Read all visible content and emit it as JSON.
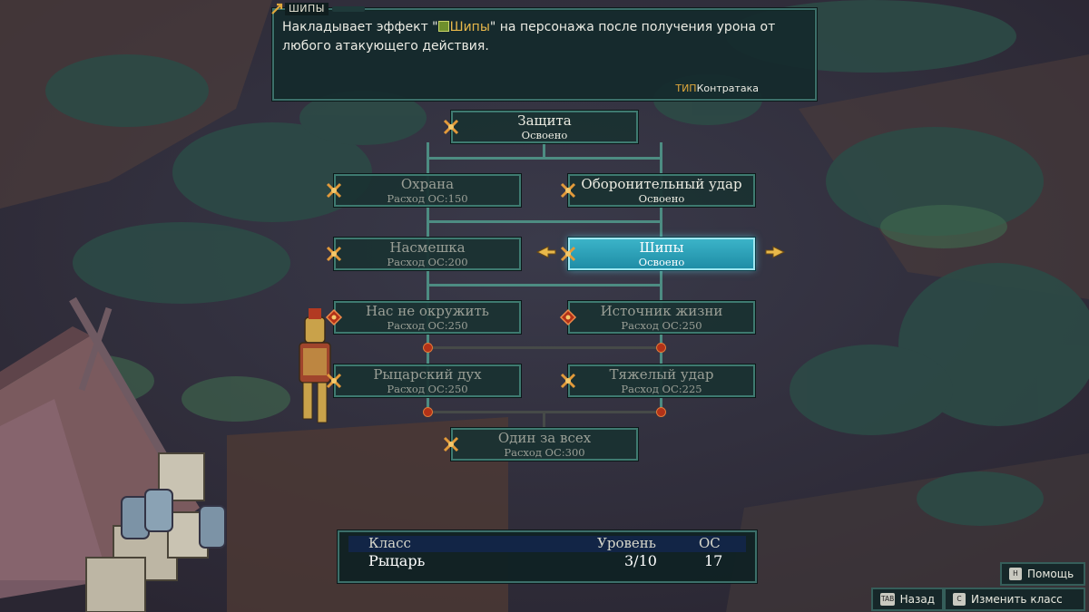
{
  "tooltip": {
    "title": "ШИПЫ",
    "desc_before": "Накладывает эффект \"",
    "desc_highlight": "Шипы",
    "desc_after": "\" на персонажа после получения урона от любого атакующего действия.",
    "type_label": "ТИП",
    "type_value": "Контратака"
  },
  "skills": {
    "zashchita": {
      "name": "Защита",
      "status": "Освоено",
      "state": "learned"
    },
    "okhrana": {
      "name": "Охрана",
      "status": "Расход ОС:150",
      "state": "locked"
    },
    "oboronit": {
      "name": "Оборонительный удар",
      "status": "Освоено",
      "state": "learned"
    },
    "nasmeshka": {
      "name": "Насмешка",
      "status": "Расход ОС:200",
      "state": "locked"
    },
    "shipy": {
      "name": "Шипы",
      "status": "Освоено",
      "state": "selected"
    },
    "nas_ne": {
      "name": "Нас не окружить",
      "status": "Расход ОС:250",
      "state": "locked"
    },
    "istochnik": {
      "name": "Источник жизни",
      "status": "Расход ОС:250",
      "state": "locked"
    },
    "rytsarsky": {
      "name": "Рыцарский дух",
      "status": "Расход ОС:250",
      "state": "locked"
    },
    "tyazhely": {
      "name": "Тяжелый удар",
      "status": "Расход ОС:225",
      "state": "locked"
    },
    "odin_za": {
      "name": "Один за всех",
      "status": "Расход ОС:300",
      "state": "locked"
    }
  },
  "class_panel": {
    "class_header": "Класс",
    "level_header": "Уровень",
    "sp_header": "ОС",
    "class_value": "Рыцарь",
    "level_value": "3/10",
    "sp_value": "17"
  },
  "buttons": {
    "help": {
      "label": "Помощь",
      "key": "H"
    },
    "back": {
      "label": "Назад",
      "key": "TAB"
    },
    "change_class": {
      "label": "Изменить класс",
      "key": "C"
    }
  },
  "colors": {
    "accent": "#3bb3c8",
    "panel_border": "#3e7a70",
    "highlight_text": "#e8b84a",
    "joint": "#b23218"
  },
  "icons": {
    "skill_badge": "crossed-swords-icon",
    "locked_badge": "red-gem-icon",
    "selector": "gold-arrow-icon"
  }
}
